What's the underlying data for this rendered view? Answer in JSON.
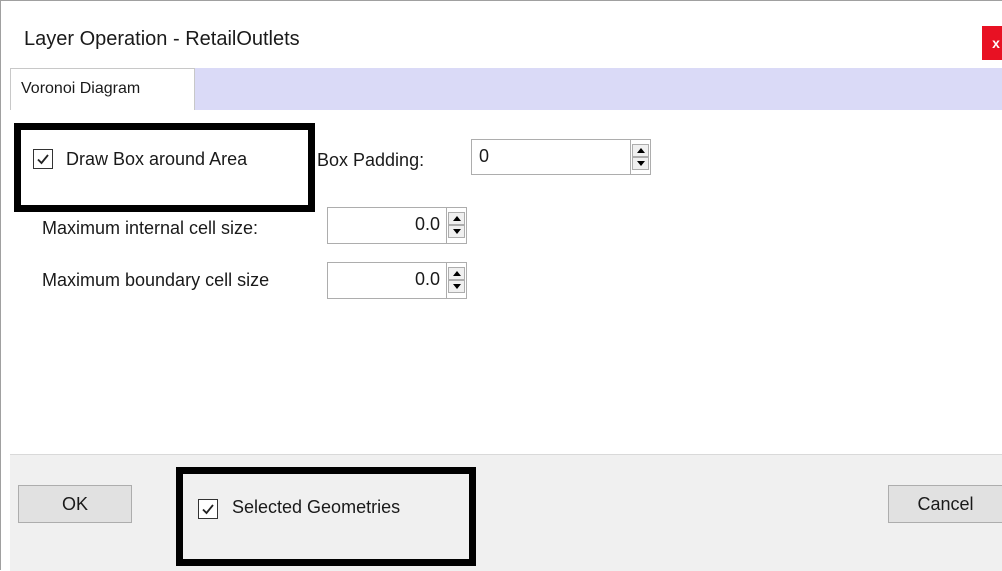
{
  "window": {
    "title": "Layer Operation - RetailOutlets",
    "close_label": "x"
  },
  "tabs": [
    {
      "label": "Voronoi Diagram",
      "active": true
    }
  ],
  "options": {
    "draw_box": {
      "label": "Draw Box around Area",
      "checked": true
    },
    "box_padding": {
      "label": "Box Padding:",
      "value": "0"
    },
    "max_internal": {
      "label": "Maximum internal cell size:",
      "value": "0.0"
    },
    "max_boundary": {
      "label": "Maximum boundary cell size",
      "value": "0.0"
    }
  },
  "footer": {
    "ok_label": "OK",
    "selected_geometries": {
      "label": "Selected Geometries",
      "checked": true
    },
    "cancel_label": "Cancel"
  },
  "colors": {
    "close_button": "#e81123",
    "tab_strip": "#dadaf7",
    "highlight_frame": "#000000"
  },
  "icons": {
    "checkmark": "check-icon",
    "spin_up": "arrow-up-icon",
    "spin_down": "arrow-down-icon"
  }
}
